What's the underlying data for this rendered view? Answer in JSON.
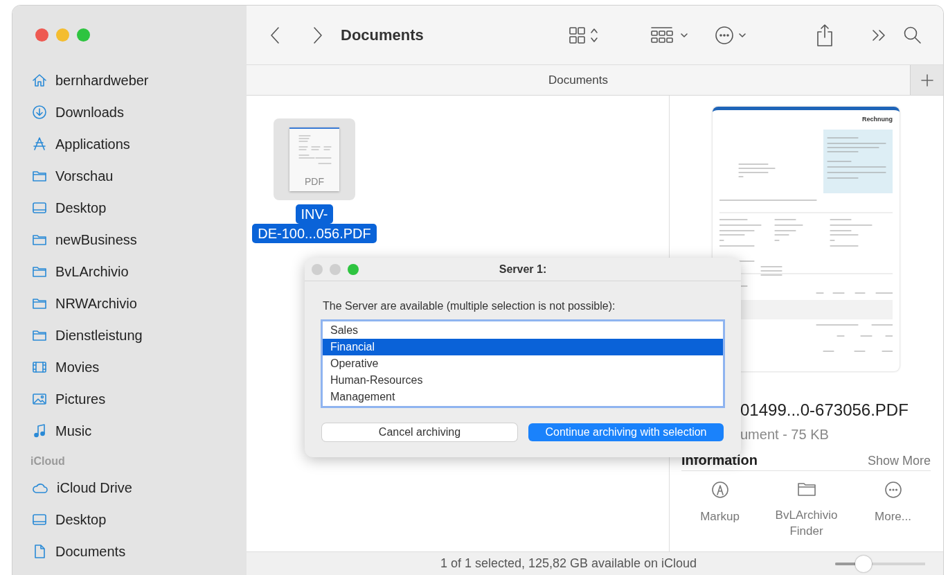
{
  "window": {
    "title": "Documents"
  },
  "sidebar": {
    "favorites": [
      {
        "label": "bernhardweber",
        "kind": "home"
      },
      {
        "label": "Downloads",
        "kind": "download"
      },
      {
        "label": "Applications",
        "kind": "apps"
      },
      {
        "label": "Vorschau",
        "kind": "folder"
      },
      {
        "label": "Desktop",
        "kind": "desktop"
      },
      {
        "label": "newBusiness",
        "kind": "folder"
      },
      {
        "label": "BvLArchivio",
        "kind": "folder"
      },
      {
        "label": "NRWArchivio",
        "kind": "folder"
      },
      {
        "label": "Dienstleistung",
        "kind": "folder"
      },
      {
        "label": "Movies",
        "kind": "film"
      },
      {
        "label": "Pictures",
        "kind": "picture"
      },
      {
        "label": "Music",
        "kind": "music"
      }
    ],
    "icloud": {
      "heading": "iCloud",
      "items": [
        {
          "label": "iCloud Drive",
          "kind": "cloud"
        },
        {
          "label": "Desktop",
          "kind": "desktop"
        },
        {
          "label": "Documents",
          "kind": "document"
        }
      ]
    }
  },
  "tab_bar": {
    "label": "Documents"
  },
  "files": [
    {
      "name_lines": [
        "INV-",
        "DE-100...056.PDF"
      ],
      "type_label": "PDF",
      "selected": true
    }
  ],
  "preview": {
    "heading": "Rechnung",
    "file_name": "01499...0-673056.PDF",
    "file_info": "ument - 75 KB",
    "section_title": "Information",
    "show_more": "Show More",
    "actions": [
      {
        "label": "Markup",
        "kind": "markup"
      },
      {
        "label": "BvLArchivio Finder",
        "kind": "folder"
      },
      {
        "label": "More...",
        "kind": "more"
      }
    ]
  },
  "status_bar": {
    "text": "1 of 1 selected, 125,82 GB available on iCloud",
    "level": 0.27
  },
  "dialog": {
    "title": "Server 1:",
    "prompt": "The Server are available (multiple selection is not possible):",
    "options": [
      {
        "label": "Sales",
        "selected": false
      },
      {
        "label": "Financial",
        "selected": true
      },
      {
        "label": "Operative",
        "selected": false
      },
      {
        "label": "Human-Resources",
        "selected": false
      },
      {
        "label": "Management",
        "selected": false
      }
    ],
    "buttons": [
      {
        "label": "Cancel archiving",
        "kind": "secondary"
      },
      {
        "label": "Continue archiving with selection",
        "kind": "primary"
      }
    ]
  }
}
